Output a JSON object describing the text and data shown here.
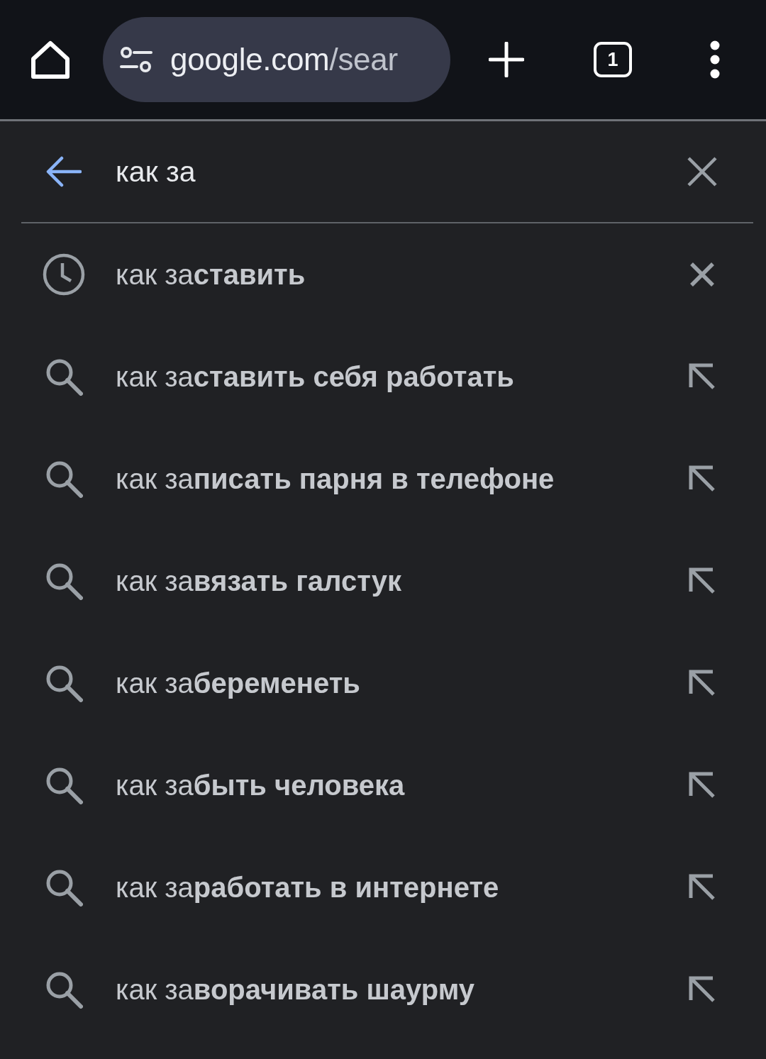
{
  "toolbar": {
    "url": {
      "host": "google.com",
      "path": "/sear"
    },
    "tab_count": "1"
  },
  "search": {
    "value": "как за"
  },
  "suggestions": [
    {
      "kind": "history",
      "text": "как за**ставить**"
    },
    {
      "kind": "search",
      "text": "как за**ставить себя работать**"
    },
    {
      "kind": "search",
      "text": "как за**писать парня в телефоне**"
    },
    {
      "kind": "search",
      "text": "как за**вязать галстук**"
    },
    {
      "kind": "search",
      "text": "как за**беременеть**"
    },
    {
      "kind": "search",
      "text": "как за**быть человека**"
    },
    {
      "kind": "search",
      "text": "как за**работать в интернете**"
    },
    {
      "kind": "search",
      "text": "как за**ворачивать шаурму**"
    }
  ]
}
